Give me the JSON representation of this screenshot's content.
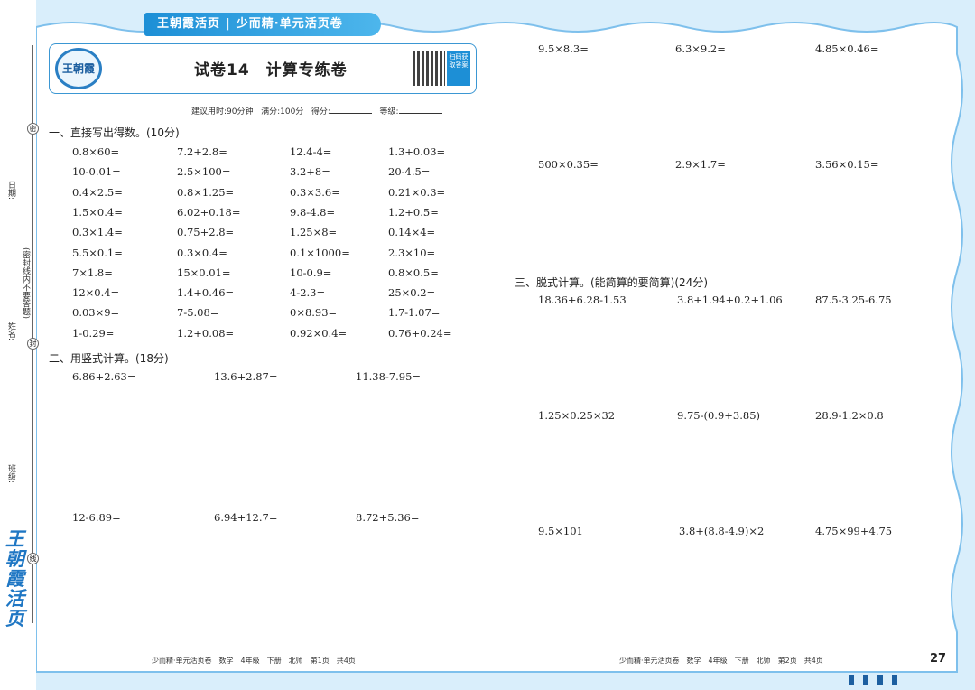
{
  "header": {
    "brand": "王朝霞活页",
    "series": "少而精·单元活页卷"
  },
  "paper": {
    "logo_text": "王朝霞",
    "title": "试卷14　计算专练卷",
    "qr_label": "扫码获取答案",
    "meta": {
      "time": "建议用时:90分钟",
      "full": "满分:100分",
      "score": "得分:",
      "grade": "等级:"
    }
  },
  "left_margin": {
    "date": "日期:",
    "name": "姓名:",
    "note": "(密封线内不要答题)",
    "class": "班级:",
    "marks": [
      "密",
      "封",
      "线"
    ],
    "brand_vertical": "王朝霞活页"
  },
  "section1": {
    "title": "一、直接写出得数。(10分)",
    "rows": [
      [
        "0.8×60=",
        "7.2+2.8=",
        "12.4-4=",
        "1.3+0.03="
      ],
      [
        "10-0.01=",
        "2.5×100=",
        "3.2+8=",
        "20-4.5="
      ],
      [
        "0.4×2.5=",
        "0.8×1.25=",
        "0.3×3.6=",
        "0.21×0.3="
      ],
      [
        "1.5×0.4=",
        "6.02+0.18=",
        "9.8-4.8=",
        "1.2+0.5="
      ],
      [
        "0.3×1.4=",
        "0.75+2.8=",
        "1.25×8=",
        "0.14×4="
      ],
      [
        "5.5×0.1=",
        "0.3×0.4=",
        "0.1×1000=",
        "2.3×10="
      ],
      [
        "7×1.8=",
        "15×0.01=",
        "10-0.9=",
        "0.8×0.5="
      ],
      [
        "12×0.4=",
        "1.4+0.46=",
        "4-2.3=",
        "25×0.2="
      ],
      [
        "0.03×9=",
        "7-5.08=",
        "0×8.93=",
        "1.7-1.07="
      ],
      [
        "1-0.29=",
        "1.2+0.08=",
        "0.92×0.4=",
        "0.76+0.24="
      ]
    ]
  },
  "section2": {
    "title": "二、用竖式计算。(18分)",
    "row1": [
      "6.86+2.63=",
      "13.6+2.87=",
      "11.38-7.95="
    ],
    "row2": [
      "12-6.89=",
      "6.94+12.7=",
      "8.72+5.36="
    ],
    "row3": [
      "9.5×8.3=",
      "6.3×9.2=",
      "4.85×0.46="
    ],
    "row4": [
      "500×0.35=",
      "2.9×1.7=",
      "3.56×0.15="
    ]
  },
  "section3": {
    "title": "三、脱式计算。(能简算的要简算)(24分)",
    "row1": [
      "18.36+6.28-1.53",
      "3.8+1.94+0.2+1.06",
      "87.5-3.25-6.75"
    ],
    "row2": [
      "1.25×0.25×32",
      "9.75-(0.9+3.85)",
      "28.9-1.2×0.8"
    ],
    "row3": [
      "9.5×101",
      "3.8+(8.8-4.9)×2",
      "4.75×99+4.75"
    ]
  },
  "footer": {
    "left": "少而精·单元活页卷　数学　4年级　下册　北师　第1页　共4页",
    "right": "少而精·单元活页卷　数学　4年级　下册　北师　第2页　共4页",
    "page_number": "27"
  },
  "colors": {
    "accent": "#1d8fd6",
    "frame": "#8cc8ee"
  }
}
